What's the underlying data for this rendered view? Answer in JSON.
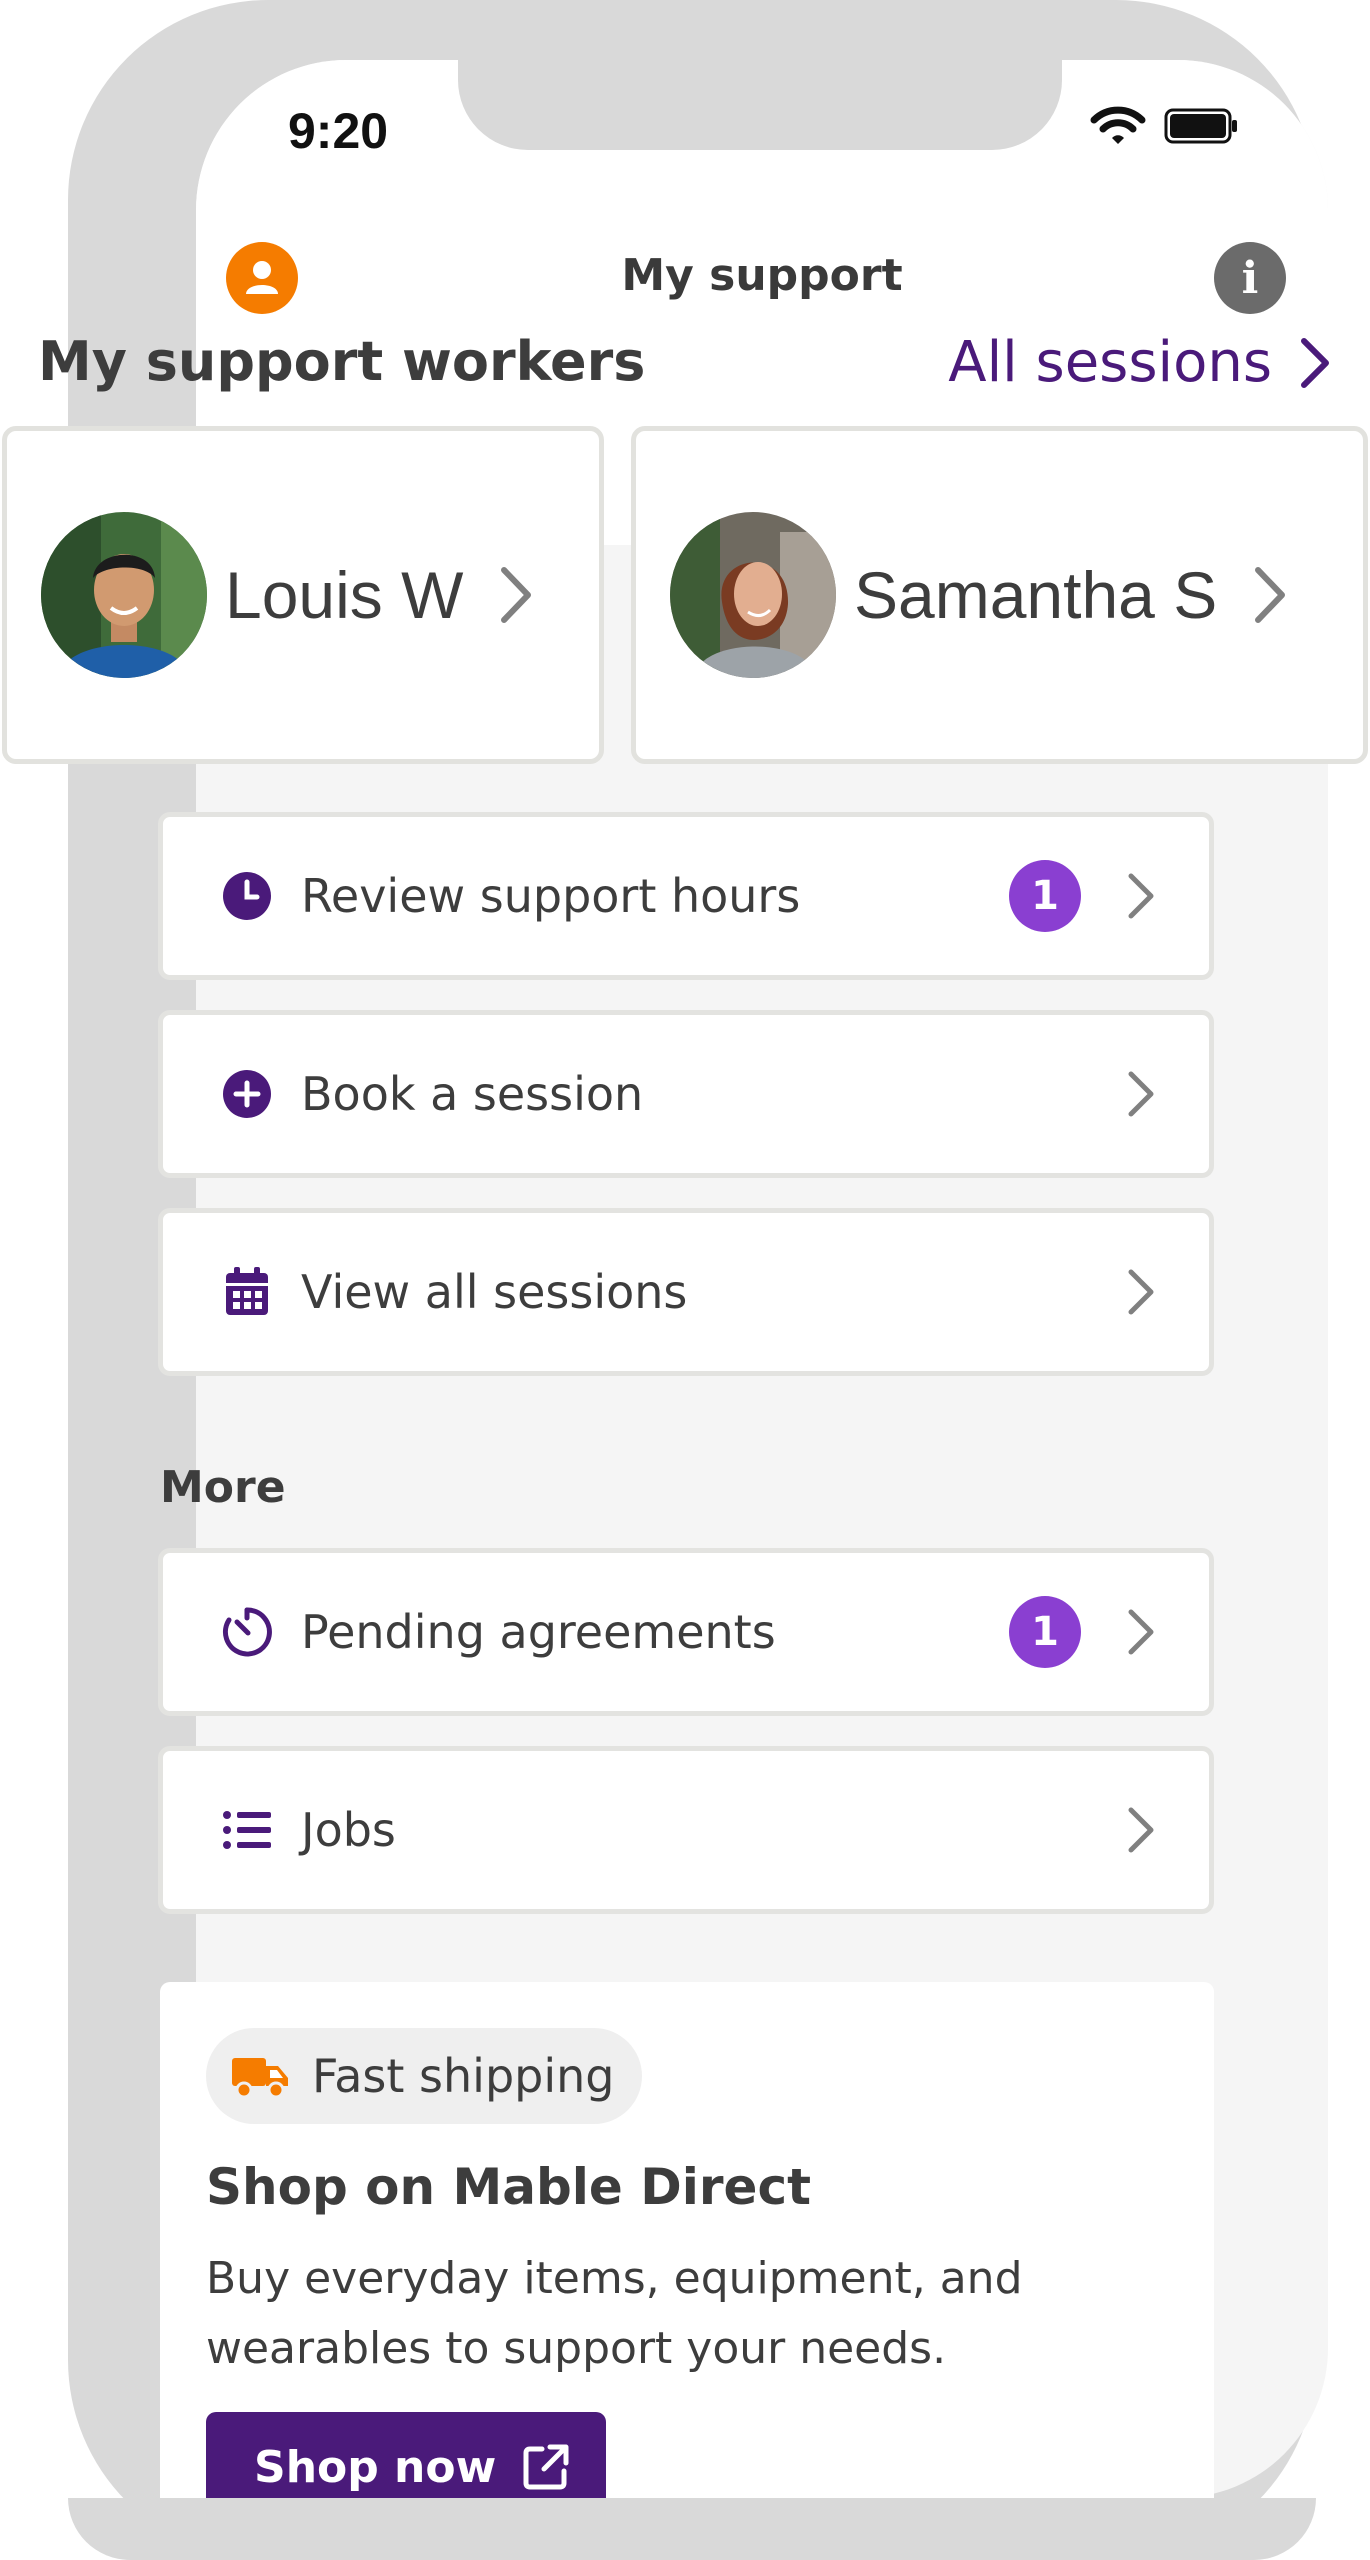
{
  "status_bar": {
    "time": "9:20"
  },
  "nav": {
    "title": "My support"
  },
  "workers": {
    "title": "My support workers",
    "all_sessions_label": "All sessions",
    "items": [
      {
        "name": "Louis W"
      },
      {
        "name": "Samantha S"
      }
    ]
  },
  "actions": [
    {
      "label": "Review support hours",
      "badge": "1",
      "icon": "clock-icon"
    },
    {
      "label": "Book a session",
      "icon": "plus-circle-icon"
    },
    {
      "label": "View all sessions",
      "icon": "calendar-icon"
    }
  ],
  "more": {
    "title": "More",
    "items": [
      {
        "label": "Pending agreements",
        "badge": "1",
        "icon": "timer-icon"
      },
      {
        "label": "Jobs",
        "icon": "list-icon"
      }
    ]
  },
  "shop": {
    "pill_label": "Fast shipping",
    "pill_icon": "truck-icon",
    "title": "Shop on Mable Direct",
    "description": "Buy everyday items, equipment, and wearables to support your needs.",
    "button_label": "Shop now",
    "button_icon": "external-link-icon"
  },
  "colors": {
    "brand_purple": "#4a1a7a",
    "badge_purple": "#8a3fd1",
    "accent_orange": "#f57c00"
  }
}
